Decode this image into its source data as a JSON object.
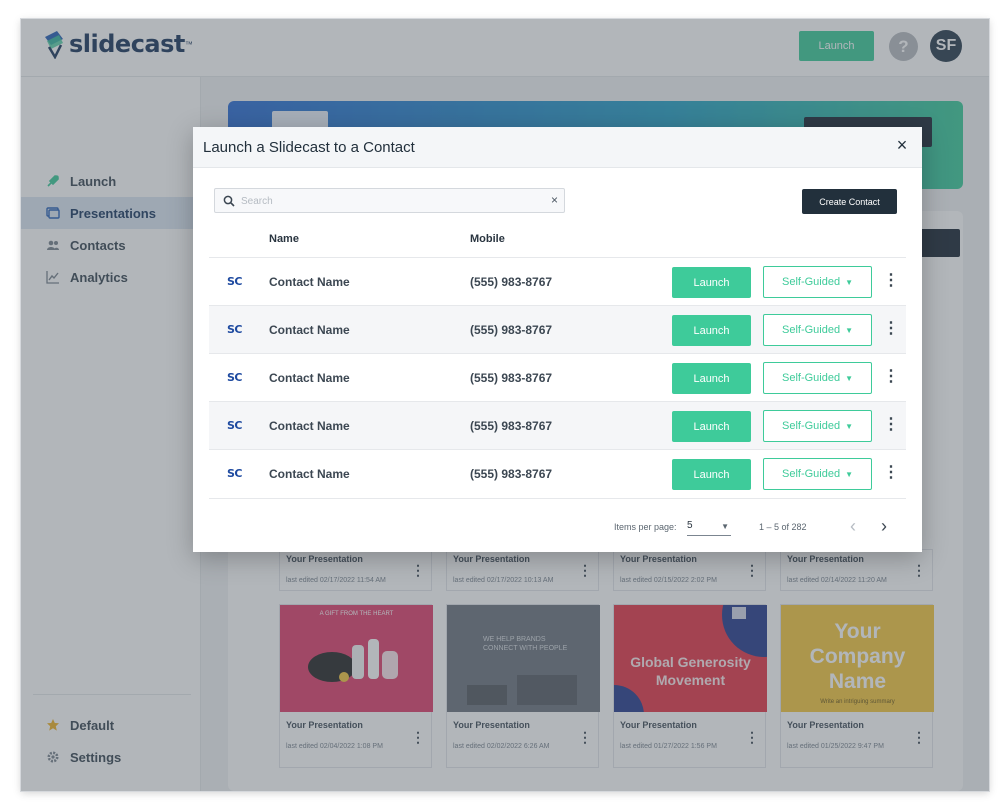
{
  "app": {
    "logo_text": "slidecast",
    "logo_tm": "™",
    "header_launch_label": "Launch",
    "help_label": "?",
    "avatar_initials": "SF"
  },
  "sidebar": {
    "items": [
      {
        "label": "Launch",
        "icon": "rocket-icon",
        "active": false
      },
      {
        "label": "Presentations",
        "icon": "presentations-icon",
        "active": true
      },
      {
        "label": "Contacts",
        "icon": "contacts-icon",
        "active": false
      },
      {
        "label": "Analytics",
        "icon": "analytics-icon",
        "active": false
      }
    ],
    "bottom": [
      {
        "label": "Default",
        "icon": "star-icon"
      },
      {
        "label": "Settings",
        "icon": "gear-icon"
      }
    ]
  },
  "cards_row1": [
    {
      "title": "Your Presentation",
      "date": "last edited 02/17/2022 11:54 AM"
    },
    {
      "title": "Your Presentation",
      "date": "last edited 02/17/2022 10:13 AM"
    },
    {
      "title": "Your Presentation",
      "date": "last edited 02/15/2022 2:02 PM"
    },
    {
      "title": "Your Presentation",
      "date": "last edited 02/14/2022 11:20 AM"
    }
  ],
  "cards_row2": [
    {
      "title": "Your Presentation",
      "date": "last edited 02/04/2022 1:08 PM",
      "thumb_text": "A GIFT FROM THE HEART",
      "thumb_color": "#e0436f"
    },
    {
      "title": "Your Presentation",
      "date": "last edited 02/02/2022 6:26 AM",
      "thumb_text": "WE HELP BRANDS CONNECT WITH PEOPLE",
      "thumb_color": "#6f7680"
    },
    {
      "title": "Your Presentation",
      "date": "last edited 01/27/2022 1:56 PM",
      "thumb_text": "Global Generosity Movement",
      "thumb_color": "#e5394a"
    },
    {
      "title": "Your Presentation",
      "date": "last edited 01/25/2022 9:47 PM",
      "thumb_text": "Your Company Name",
      "thumb_sub": "Write an intriguing summary",
      "thumb_color": "#f5c842"
    }
  ],
  "modal": {
    "title": "Launch a Slidecast to a Contact",
    "close": "×",
    "search_placeholder": "Search",
    "search_clear": "×",
    "create_label": "Create Contact",
    "col_name": "Name",
    "col_mobile": "Mobile",
    "row_logo": "SC",
    "launch_label": "Launch",
    "mode_label": "Self-Guided",
    "rows": [
      {
        "name": "Contact Name",
        "mobile": "(555) 983-8767"
      },
      {
        "name": "Contact Name",
        "mobile": "(555) 983-8767"
      },
      {
        "name": "Contact Name",
        "mobile": "(555) 983-8767"
      },
      {
        "name": "Contact Name",
        "mobile": "(555) 983-8767"
      },
      {
        "name": "Contact Name",
        "mobile": "(555) 983-8767"
      }
    ],
    "items_per_page_label": "Items per page:",
    "items_per_page": "5",
    "range_label": "1 – 5 of 282"
  },
  "colors": {
    "accent": "#3ecb9a",
    "dark": "#22303c",
    "logo_blue": "#1e4aa0"
  }
}
